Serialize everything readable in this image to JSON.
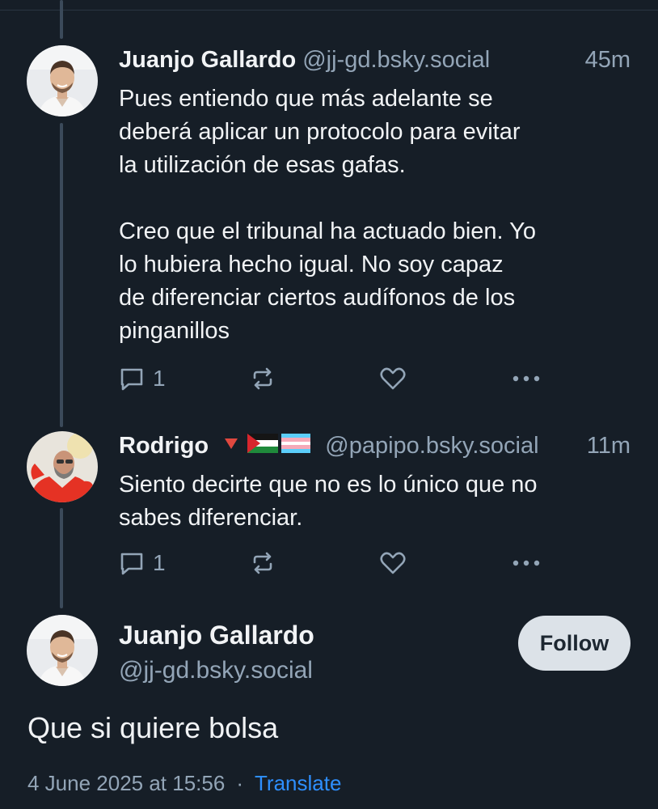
{
  "posts": [
    {
      "name": "Juanjo Gallardo",
      "handle": "@jj-gd.bsky.social",
      "time": "45m",
      "text": "Pues entiendo que más adelante se\ndeberá aplicar un protocolo para evitar\nla utilización de esas gafas.\n\nCreo que el tribunal ha actuado bien. Yo\nlo hubiera hecho igual. No soy capaz\nde diferenciar ciertos audífonos de los\npinganillos",
      "reply_count": "1"
    },
    {
      "name": "Rodrigo",
      "name_emoji": "🔻🇵🇸🏳️‍⚧️",
      "handle": "@papipo.bsky.social",
      "time": "11m",
      "text": "Siento decirte que no es lo único que no\nsabes diferenciar.",
      "reply_count": "1"
    }
  ],
  "main_post": {
    "name": "Juanjo Gallardo",
    "handle": "@jj-gd.bsky.social",
    "follow_label": "Follow",
    "text": "Que si quiere bolsa",
    "timestamp": "4 June 2025 at 15:56",
    "separator": "·",
    "translate_label": "Translate"
  },
  "icons": {
    "reply": "speech-bubble-icon",
    "repost": "repost-arrows-icon",
    "like": "heart-icon",
    "more": "ellipsis-icon"
  },
  "colors": {
    "background": "#161e27",
    "text": "#f1f3f5",
    "muted": "#93a5b7",
    "link": "#2e8fff",
    "button": "#dce2e8"
  }
}
